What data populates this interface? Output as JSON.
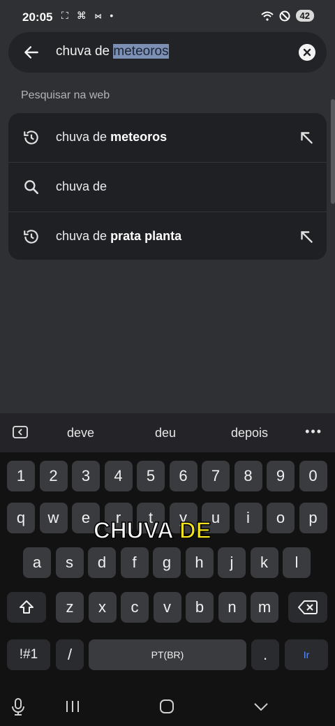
{
  "status": {
    "time": "20:05",
    "left_icons": "⛶ ⌘ ⋈ •",
    "battery": "42"
  },
  "search": {
    "query_prefix": "chuva de ",
    "query_selected": "meteoros"
  },
  "section_label": "Pesquisar na web",
  "suggestions": [
    {
      "prefix": "chuva de ",
      "bold": "meteoros",
      "icon": "history-icon"
    },
    {
      "prefix": "chuva de",
      "bold": "",
      "icon": "search-icon"
    },
    {
      "prefix": "chuva de ",
      "bold": "prata planta",
      "icon": "history-icon"
    }
  ],
  "predictions": [
    "deve",
    "deu",
    "depois"
  ],
  "keys": {
    "numbers": [
      "1",
      "2",
      "3",
      "4",
      "5",
      "6",
      "7",
      "8",
      "9",
      "0"
    ],
    "row1": [
      "q",
      "w",
      "e",
      "r",
      "t",
      "y",
      "u",
      "i",
      "o",
      "p"
    ],
    "row2": [
      "a",
      "s",
      "d",
      "f",
      "g",
      "h",
      "j",
      "k",
      "l"
    ],
    "row3": [
      "z",
      "x",
      "c",
      "v",
      "b",
      "n",
      "m"
    ],
    "symbols": "!#1",
    "slash": "/",
    "space": "PT(BR)",
    "period": ".",
    "go": "Ir"
  },
  "overlay": {
    "white": "CHUVA ",
    "yellow": "DE"
  },
  "colors": {
    "accent_go": "#5a8dff",
    "selection": "#7c8fb5",
    "overlay_yellow": "#f3e31e"
  }
}
